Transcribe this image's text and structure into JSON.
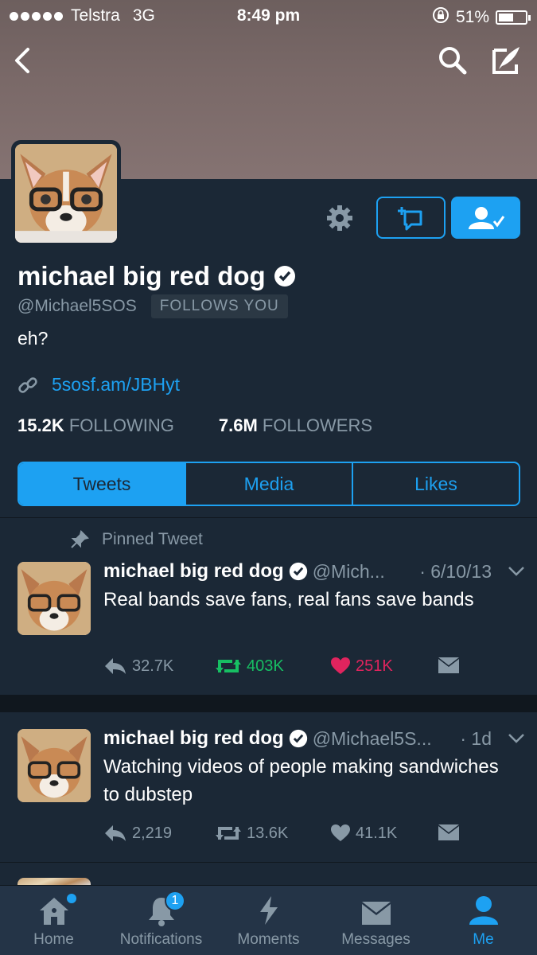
{
  "status": {
    "carrier": "Telstra",
    "network": "3G",
    "time": "8:49 pm",
    "battery": "51%",
    "battery_level": 0.51
  },
  "header": {
    "back_icon": "chevron-left-icon",
    "search_icon": "search-icon",
    "compose_icon": "compose-icon"
  },
  "profile": {
    "name": "michael big red dog",
    "handle": "@Michael5SOS",
    "follows_you": "FOLLOWS YOU",
    "bio": "eh?",
    "link": "5sosf.am/JBHyt",
    "following_count": "15.2K",
    "following_label": "FOLLOWING",
    "followers_count": "7.6M",
    "followers_label": "FOLLOWERS"
  },
  "tabs": [
    {
      "label": "Tweets",
      "active": true
    },
    {
      "label": "Media",
      "active": false
    },
    {
      "label": "Likes",
      "active": false
    }
  ],
  "pinned_label": "Pinned Tweet",
  "tweets": [
    {
      "name": "michael big red dog",
      "handle": "@Mich...",
      "date": "· 6/10/13",
      "text": "Real bands save fans, real fans save bands",
      "replies": "32.7K",
      "retweets": "403K",
      "likes": "251K"
    },
    {
      "name": "michael big red dog",
      "handle": "@Michael5S...",
      "date": "· 1d",
      "text": "Watching videos of people making sandwiches to dubstep",
      "replies": "2,219",
      "retweets": "13.6K",
      "likes": "41.1K"
    }
  ],
  "tabbar": [
    {
      "label": "Home"
    },
    {
      "label": "Notifications",
      "badge": "1"
    },
    {
      "label": "Moments"
    },
    {
      "label": "Messages"
    },
    {
      "label": "Me"
    }
  ],
  "colors": {
    "accent": "#1da1f2",
    "background": "#1b2836",
    "retweet": "#17bf63",
    "like": "#e0245e"
  }
}
